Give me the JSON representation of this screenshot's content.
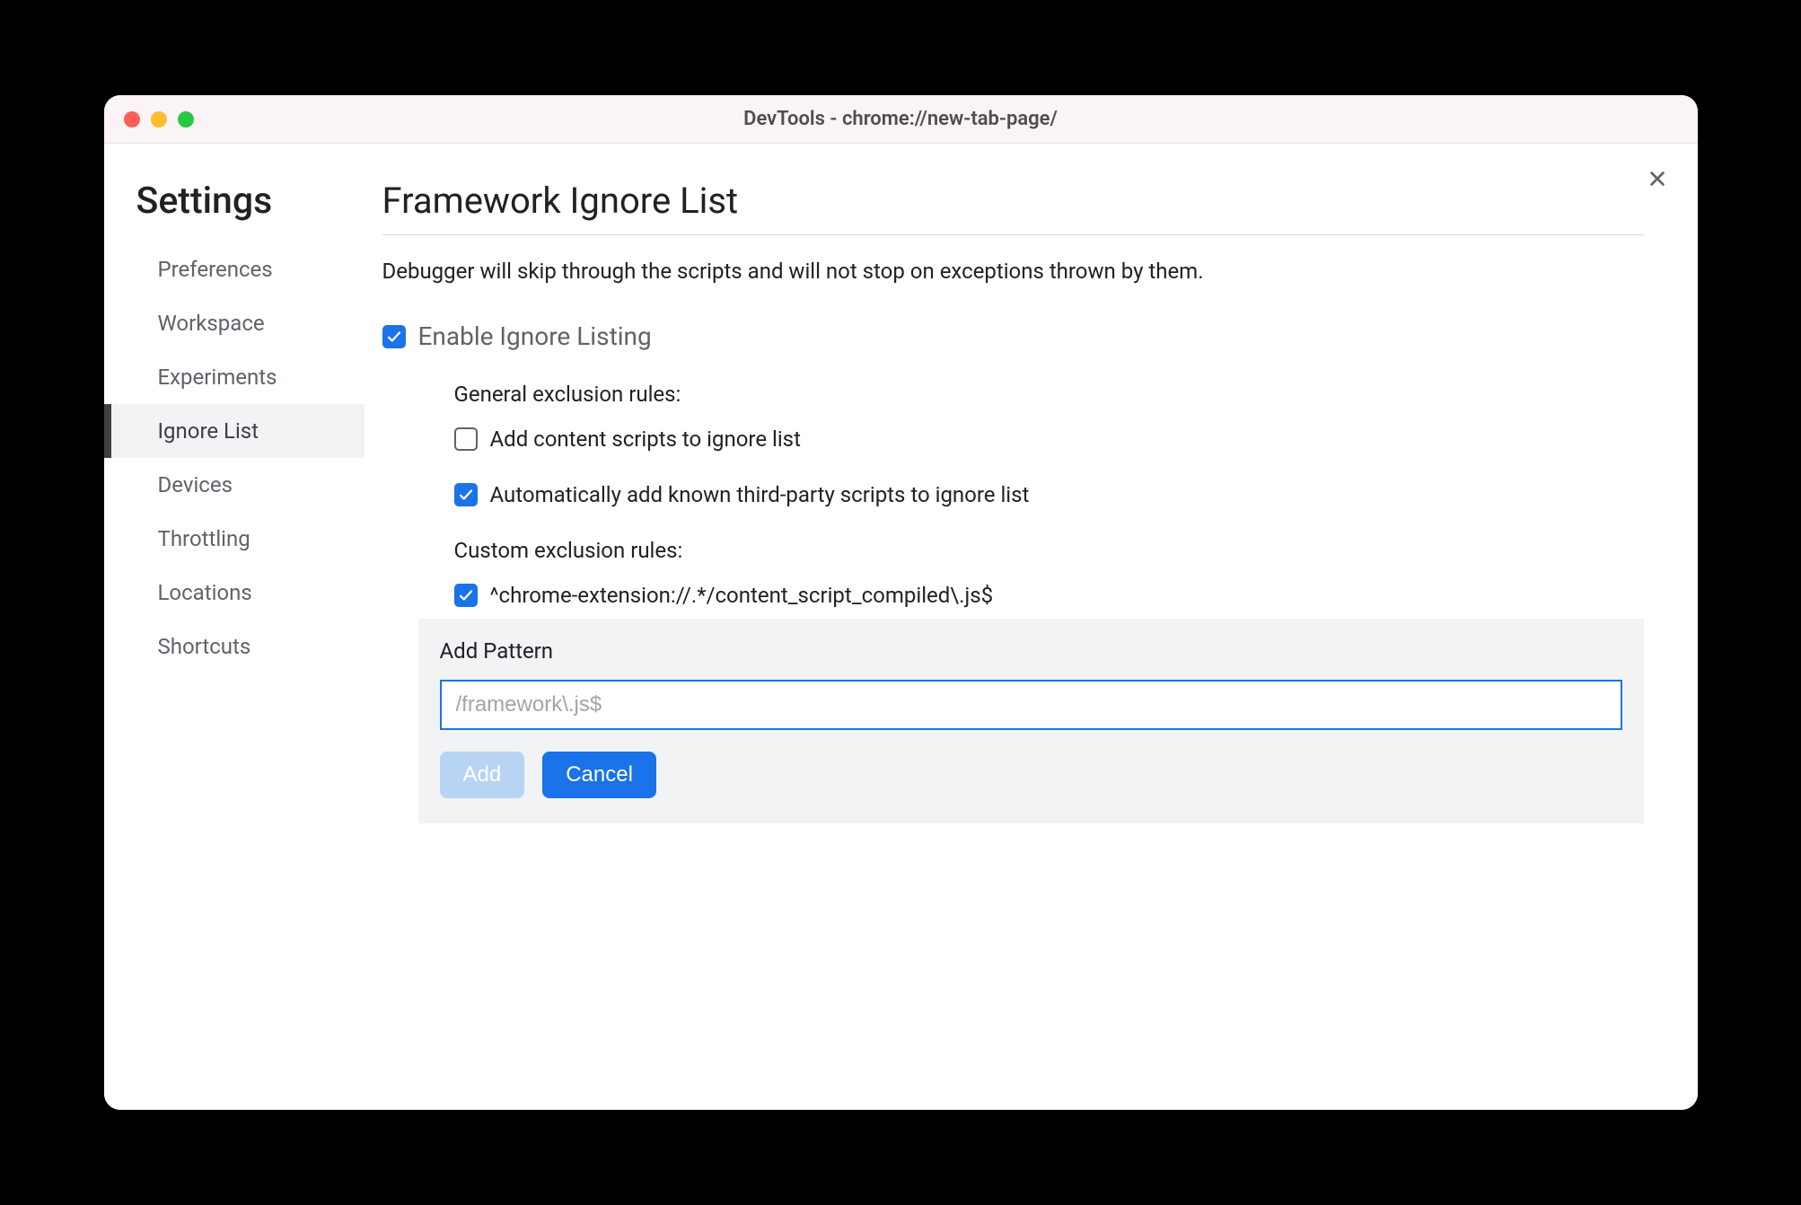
{
  "titlebar": {
    "title": "DevTools - chrome://new-tab-page/"
  },
  "sidebar": {
    "title": "Settings",
    "items": [
      {
        "label": "Preferences",
        "active": false
      },
      {
        "label": "Workspace",
        "active": false
      },
      {
        "label": "Experiments",
        "active": false
      },
      {
        "label": "Ignore List",
        "active": true
      },
      {
        "label": "Devices",
        "active": false
      },
      {
        "label": "Throttling",
        "active": false
      },
      {
        "label": "Locations",
        "active": false
      },
      {
        "label": "Shortcuts",
        "active": false
      }
    ]
  },
  "main": {
    "title": "Framework Ignore List",
    "description": "Debugger will skip through the scripts and will not stop on exceptions thrown by them.",
    "enable": {
      "label": "Enable Ignore Listing",
      "checked": true
    },
    "general_section_label": "General exclusion rules:",
    "general_rules": [
      {
        "label": "Add content scripts to ignore list",
        "checked": false
      },
      {
        "label": "Automatically add known third-party scripts to ignore list",
        "checked": true
      }
    ],
    "custom_section_label": "Custom exclusion rules:",
    "custom_rules": [
      {
        "label": "^chrome-extension://.*/content_script_compiled\\.js$",
        "checked": true
      }
    ],
    "add_pattern": {
      "title": "Add Pattern",
      "placeholder": "/framework\\.js$",
      "value": "",
      "add_label": "Add",
      "cancel_label": "Cancel"
    }
  }
}
